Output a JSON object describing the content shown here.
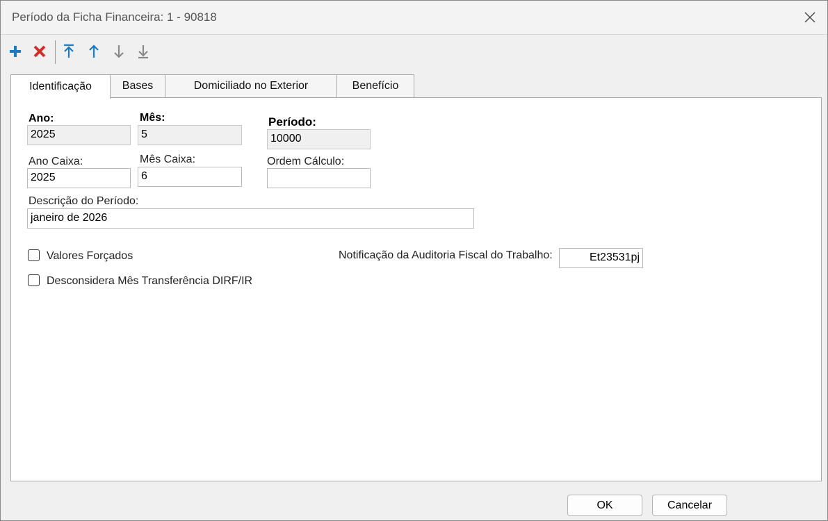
{
  "window": {
    "title": "Período da Ficha Financeira: 1 - 90818"
  },
  "toolbar": {
    "buttons": [
      "add-icon",
      "delete-icon",
      "move-first-icon",
      "move-up-icon",
      "move-down-icon",
      "move-last-icon"
    ],
    "colors": {
      "add": "#1a7bc4",
      "delete": "#d0302a",
      "nav": "#1a7bc4",
      "nav_disabled": "#8a8a8a"
    }
  },
  "tabs": [
    {
      "label": "Identificação",
      "active": true
    },
    {
      "label": "Bases"
    },
    {
      "label": "Domiciliado no Exterior"
    },
    {
      "label": "Benefício"
    }
  ],
  "form": {
    "ano": {
      "label": "Ano:",
      "value": "2025"
    },
    "mes": {
      "label": "Mês:",
      "value": "5"
    },
    "periodo": {
      "label": "Período:",
      "value": "10000"
    },
    "ano_caixa": {
      "label": "Ano Caixa:",
      "value": "2025"
    },
    "mes_caixa": {
      "label": "Mês Caixa:",
      "value": "6"
    },
    "ordem_calculo": {
      "label": "Ordem Cálculo:",
      "value": ""
    },
    "descricao": {
      "label": "Descrição do Período:",
      "value": "janeiro de 2026"
    },
    "valores_forcados": {
      "label": "Valores Forçados",
      "checked": false
    },
    "desconsidera": {
      "label": "Desconsidera Mês Transferência DIRF/IR",
      "checked": false
    },
    "notificacao": {
      "label": "Notificação da Auditoria Fiscal do Trabalho:",
      "value": "Et23531pj"
    }
  },
  "buttons": {
    "ok": "OK",
    "cancel": "Cancelar"
  }
}
